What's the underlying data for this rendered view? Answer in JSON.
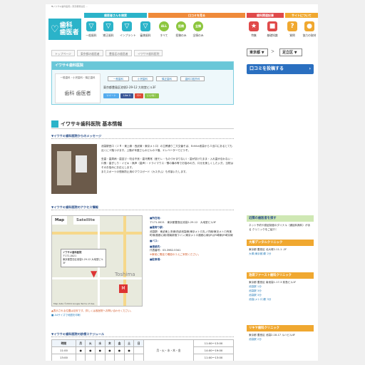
{
  "tagline": "▼イワサキ歯科医院 | 東京都豊島区 …",
  "logo": {
    "text_line1": "歯科",
    "text_line2": "歯医者"
  },
  "categories": [
    {
      "label": "歯医者さんを検索",
      "color": "#2bb3c9"
    },
    {
      "label": "口コミを見る",
      "color": "#ef8a3a"
    },
    {
      "label": "歯科関連記事",
      "color": "#e04a4a"
    },
    {
      "label": "サイトについて",
      "color": "#f0a830"
    }
  ],
  "nav": [
    {
      "label": "一般歯科",
      "icon": "tooth-icon",
      "glyph": "▽",
      "color": "#2bb3c9"
    },
    {
      "label": "矯正歯科",
      "icon": "tooth-braces-icon",
      "glyph": "▽",
      "color": "#2bb3c9"
    },
    {
      "label": "インプラント",
      "icon": "implant-icon",
      "glyph": "▽",
      "color": "#2bb3c9"
    },
    {
      "label": "審美歯科",
      "icon": "tooth-sparkle-icon",
      "glyph": "▽",
      "color": "#2bb3c9"
    },
    {
      "label": "すべて",
      "icon": "all-icon",
      "glyph": "ALL",
      "color": "#8dc63f"
    },
    {
      "label": "投稿のみ",
      "icon": "post-icon",
      "glyph": "投稿",
      "color": "#8dc63f"
    },
    {
      "label": "全情のみ",
      "icon": "info-icon",
      "glyph": "全情",
      "color": "#8dc63f"
    },
    {
      "label": "特集",
      "icon": "feature-icon",
      "glyph": "★",
      "color": "#e04a4a"
    },
    {
      "label": "基礎知識",
      "icon": "book-icon",
      "glyph": "■",
      "color": "#e04a4a"
    },
    {
      "label": "質問",
      "icon": "question-icon",
      "glyph": "?",
      "color": "#f0a830"
    },
    {
      "label": "協力の取材",
      "icon": "interview-icon",
      "glyph": "●",
      "color": "#f0a830"
    }
  ],
  "breadcrumb": [
    "トップページ",
    "東京都の歯医者",
    "豊島区の歯医者",
    "イワサキ歯科医院"
  ],
  "area": {
    "prefecture": "東京都 ▼",
    "sep": "＞",
    "ward": "足立区 ▼"
  },
  "clinic": {
    "name": "イワサキ歯科医院",
    "logo_caption": "一般歯科・小児歯科・矯正歯科",
    "logo_text": "歯科 歯医者",
    "tags": [
      "一般歯科",
      "小児歯科",
      "矯正歯科",
      "歯科口腔外科"
    ],
    "address": "東京都豊島区池袋2-29-12 大地堂ビル3F",
    "sns": [
      {
        "label": "ツイート",
        "color": "#55acee"
      },
      {
        "label": "Like 0",
        "color": "#3b5998"
      },
      {
        "label": "G+",
        "color": "#dd4b39"
      },
      {
        "label": "いいね！",
        "color": "#8bc34a"
      }
    ]
  },
  "review_button": "口コミを投稿する",
  "basic_info_title": "イワサキ歯科医院 基本情報",
  "message": {
    "heading": "▼イワサキ歯科医院からのメッセージ",
    "body": "池袋駅西口（ＪＲ・東上線・西武線・東京メトロ）の立教通り二又交番そば、Echika池袋から３出口にあるとても近くに２階つけます。上階が本屋さんのビルの３階、エレベーターでどうぞ。\n\n虫歯・歯周病・歯並び・咬合不良・歯牙異常（差モレ・ものづかまりない）・歯が抜けたまま・入れ歯が合わない・口臭・歯ぎしり・イビキ・無声（歯声）・ドライマウス・顎の痛み等でお悩みの方、口元を美しくしたい方、当院はそのお悩みにお応えします。\nまたスポーツの怪我防止用のマウスガード（カスタム）も作製いたします。"
  },
  "access": {
    "heading": "▼イワサキ歯科医院のアクセス情報",
    "map_tab": "Map",
    "sat_tab": "Satellite",
    "bubble_title": "イワサキ歯科医院",
    "bubble_addr": "〒171-0021\n東京都豊島区池袋2-29-12 大地堂ビル3F",
    "map_label": "Toshima",
    "map_footer": "Map data ©2016 Google  Terms of Use",
    "metro_glyph": "M",
    "addr_label": "■所在地：",
    "addr": "〒171-0021　東京都豊島区池袋2-29-12　大地堂ビル3F",
    "station_label": "■最寄り駅：",
    "station": "池袋駅：東武東上本線/西武池袋線/東京メトロ丸ノ内線/東京メトロ有楽町線/副都心線/湘南新宿ライン/東京メトロ副都心線(JR)/JR埼線/JR埼京線",
    "bus_label": "■バス：",
    "bus": "",
    "contact_label": "■連絡先：",
    "tel": "代表番号：03-3982-5341",
    "note": "※事前に電話で確認のうえご来院ください。",
    "parking_label": "■駐車場：",
    "parking": "",
    "below_map1": "▲表示される位置は目安です。詳しくは各医院へお問い合わせください。",
    "below_map2": "A4サイズで地図を印刷"
  },
  "schedule": {
    "heading": "▼イワサキ歯科医院の診療スケジュール",
    "headers": [
      "時間",
      "月",
      "火",
      "水",
      "木",
      "金",
      "土",
      "日"
    ],
    "rows": [
      [
        "11:00",
        "●",
        "●",
        "●",
        "●",
        "●",
        "●",
        ""
      ],
      [
        "13:00",
        "",
        "",
        "",
        "",
        "",
        "",
        ""
      ]
    ],
    "days_label": "月・火・水・木・金",
    "hours": [
      "11:00〜13:00",
      "14:00〜19:00",
      "11:00〜13:00",
      "14:00〜19:00"
    ],
    "sub_label": "土"
  },
  "sidebar": [
    {
      "head": "近隣の歯医者を探す",
      "color": "#cfe8b4",
      "body": "ネット予約や認証制度のダイナル（通話料無料）がある クリニックをご紹介！",
      "items": []
    },
    {
      "head": "大塚デンタルクリニック",
      "color": "#f0a830",
      "body": "東京都 豊島区 北大塚2-11-1 -2F",
      "items": [
        "大塚(東京都)駅 2分"
      ]
    },
    {
      "head": "池袋ファースト歯科クリニック",
      "color": "#f0a830",
      "body": "東京都 豊島区 南池袋1-17-3 前島ビル1F",
      "items": [
        "池袋駅 1分",
        "池袋駅 3分",
        "池袋駅 3分",
        "池袋(メトロ)駅 3分"
      ]
    },
    {
      "head": "リキヤ歯科クリニック",
      "color": "#f0a830",
      "body": "東京都 豊島区 池袋2-18-17 ルハビル4F",
      "items": [
        "池袋駅 2分"
      ]
    }
  ]
}
